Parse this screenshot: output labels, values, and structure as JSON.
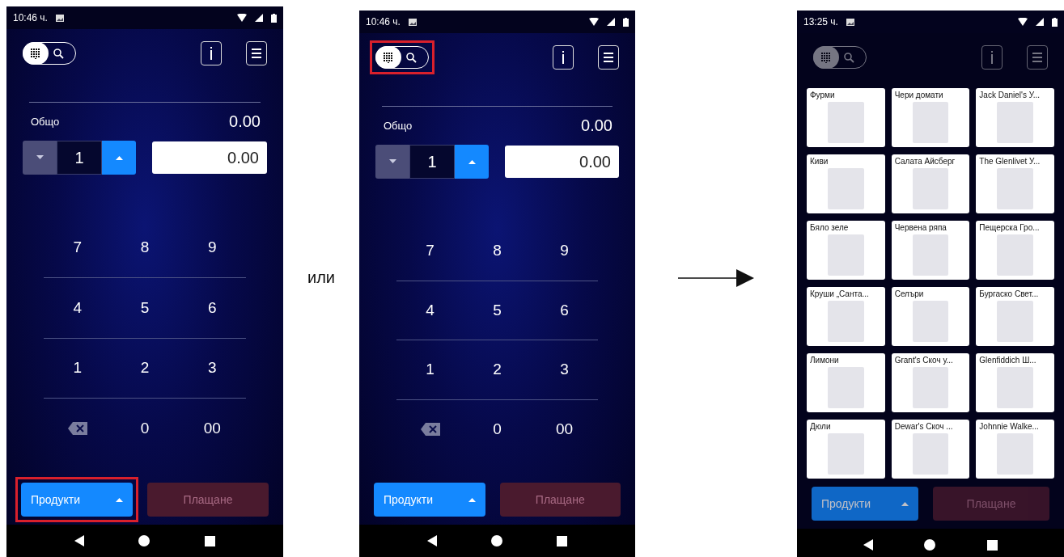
{
  "screens": [
    {
      "kind": "keypad",
      "time": "10:46 ч.",
      "mode_toggle": {
        "highlighted": false,
        "options": [
          {
            "kind": "keypad",
            "selected": true
          },
          {
            "kind": "search",
            "selected": false
          }
        ]
      },
      "total_label": "Общо",
      "total_value": "0.00",
      "quantity": "1",
      "price": "0.00",
      "keys": [
        {
          "kind": "digit",
          "label": "7"
        },
        {
          "kind": "digit",
          "label": "8"
        },
        {
          "kind": "digit",
          "label": "9"
        },
        {
          "kind": "digit",
          "label": "4"
        },
        {
          "kind": "digit",
          "label": "5"
        },
        {
          "kind": "digit",
          "label": "6"
        },
        {
          "kind": "digit",
          "label": "1"
        },
        {
          "kind": "digit",
          "label": "2"
        },
        {
          "kind": "digit",
          "label": "3"
        },
        {
          "kind": "backspace"
        },
        {
          "kind": "digit",
          "label": "0"
        },
        {
          "kind": "digit",
          "label": "00"
        }
      ],
      "products_button": {
        "label": "Продукти",
        "highlighted": true
      },
      "pay_button": {
        "label": "Плащане",
        "disabled": true
      }
    },
    {
      "kind": "keypad",
      "time": "10:46 ч.",
      "mode_toggle": {
        "highlighted": true,
        "options": [
          {
            "kind": "keypad",
            "selected": true
          },
          {
            "kind": "search",
            "selected": false
          }
        ]
      },
      "total_label": "Общо",
      "total_value": "0.00",
      "quantity": "1",
      "price": "0.00",
      "keys": [
        {
          "kind": "digit",
          "label": "7"
        },
        {
          "kind": "digit",
          "label": "8"
        },
        {
          "kind": "digit",
          "label": "9"
        },
        {
          "kind": "digit",
          "label": "4"
        },
        {
          "kind": "digit",
          "label": "5"
        },
        {
          "kind": "digit",
          "label": "6"
        },
        {
          "kind": "digit",
          "label": "1"
        },
        {
          "kind": "digit",
          "label": "2"
        },
        {
          "kind": "digit",
          "label": "3"
        },
        {
          "kind": "backspace"
        },
        {
          "kind": "digit",
          "label": "0"
        },
        {
          "kind": "digit",
          "label": "00"
        }
      ],
      "products_button": {
        "label": "Продукти",
        "highlighted": false
      },
      "pay_button": {
        "label": "Плащане",
        "disabled": true
      }
    },
    {
      "kind": "products",
      "time": "13:25 ч.",
      "mode_toggle": {
        "highlighted": false,
        "options": [
          {
            "kind": "keypad",
            "selected": true
          },
          {
            "kind": "search",
            "selected": false
          }
        ]
      },
      "products": [
        {
          "name": "Фурми"
        },
        {
          "name": "Чери домати"
        },
        {
          "name": "Jack Daniel's У..."
        },
        {
          "name": "Киви"
        },
        {
          "name": "Салата Айсберг"
        },
        {
          "name": "The Glenlivet У..."
        },
        {
          "name": "Бяло зеле"
        },
        {
          "name": "Червена ряпа"
        },
        {
          "name": "Пещерска Гро..."
        },
        {
          "name": "Круши „Санта..."
        },
        {
          "name": "Селъри"
        },
        {
          "name": "Бургаско Свет..."
        },
        {
          "name": "Лимони"
        },
        {
          "name": "Grant's Скоч у..."
        },
        {
          "name": "Glenfiddich Ш..."
        },
        {
          "name": "Дюли"
        },
        {
          "name": "Dewar's Скоч ..."
        },
        {
          "name": "Johnnie Walke..."
        }
      ],
      "products_button": {
        "label": "Продукти",
        "highlighted": false
      },
      "pay_button": {
        "label": "Плащане",
        "disabled": true
      }
    }
  ],
  "between": [
    {
      "kind": "word",
      "text": "или"
    },
    {
      "kind": "arrow"
    }
  ]
}
